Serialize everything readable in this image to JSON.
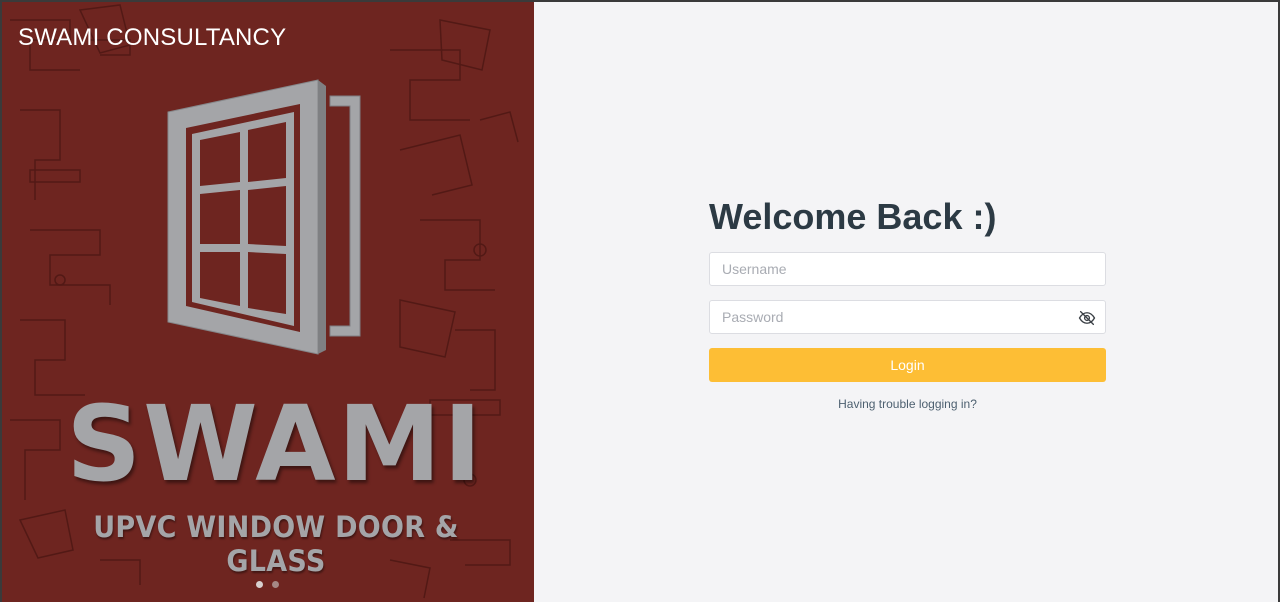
{
  "brand": {
    "title": "SWAMI CONSULTANCY"
  },
  "hero": {
    "logo_word": "SWAMI",
    "logo_tagline": "UPVC WINDOW DOOR & GLASS",
    "slides": 2,
    "active_slide": 1
  },
  "login": {
    "heading": "Welcome Back :)",
    "username_placeholder": "Username",
    "password_placeholder": "Password",
    "password_toggle_icon": "eye-off-icon",
    "submit_label": "Login",
    "trouble_link": "Having trouble logging in?"
  },
  "colors": {
    "hero_background": "#6e2520",
    "accent": "#fdbe35",
    "page_background": "#f4f4f6",
    "heading": "#2c3a44"
  }
}
